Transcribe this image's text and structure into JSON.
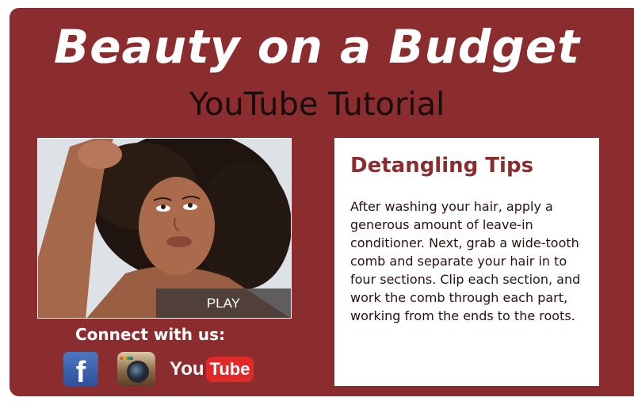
{
  "header": {
    "title": "Beauty on a Budget",
    "subtitle": "YouTube Tutorial"
  },
  "video": {
    "play_label": "PLAY"
  },
  "social": {
    "heading": "Connect with us:",
    "facebook_glyph": "f",
    "youtube_you": "You",
    "youtube_tube": "Tube",
    "icons": [
      "facebook-icon",
      "instagram-icon",
      "youtube-icon"
    ]
  },
  "tips": {
    "heading": "Detangling Tips",
    "body": "After washing your hair, apply a generous amount of leave-in conditioner. Next, grab a wide-tooth comb and separate your hair in to four sections. Clip each section, and work the comb through each part, working from the ends to the roots."
  },
  "colors": {
    "brand": "#8b2c2f",
    "text_light": "#ffffff",
    "text_dark": "#1a0d0d",
    "youtube_red": "#e02a2a",
    "facebook_blue": "#3b5998"
  }
}
